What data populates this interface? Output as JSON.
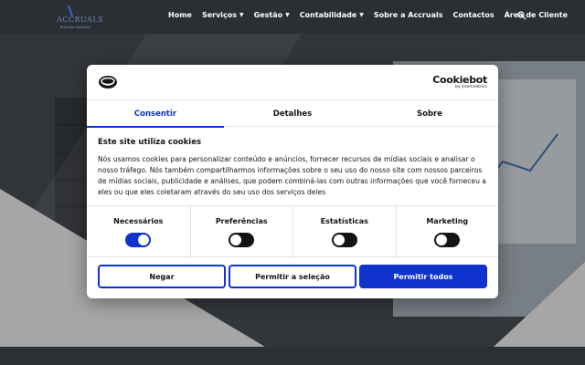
{
  "header": {
    "logo_name": "ACCRUALS",
    "logo_tagline": "Business Solutions",
    "nav": [
      {
        "label": "Home",
        "dropdown": false
      },
      {
        "label": "Serviços",
        "dropdown": true
      },
      {
        "label": "Gestão",
        "dropdown": true
      },
      {
        "label": "Contabilidade",
        "dropdown": true
      },
      {
        "label": "Sobre a Accruals",
        "dropdown": false
      },
      {
        "label": "Contactos",
        "dropdown": false
      },
      {
        "label": "Área de Cliente",
        "dropdown": false
      }
    ]
  },
  "consent": {
    "brand_name": "Cookiebot",
    "brand_sub": "by Usercentrics",
    "tabs": [
      {
        "label": "Consentir",
        "active": true
      },
      {
        "label": "Detalhes",
        "active": false
      },
      {
        "label": "Sobre",
        "active": false
      }
    ],
    "heading": "Este site utiliza cookies",
    "text": "Nós usamos cookies para personalizar conteúdo e anúncios, fornecer recursos de mídias sociais e analisar o nosso tráfego. Nós também compartilharmos informações sobre o seu uso do nosso site com nossos parceiros de mídias sociais, publicidade e análises, que podem combiná-las com outras informações que você forneceu a eles ou que eles coletaram através do seu uso dos serviços deles",
    "toggles": [
      {
        "label": "Necessários",
        "on": true
      },
      {
        "label": "Preferências",
        "on": false
      },
      {
        "label": "Estatísticas",
        "on": false
      },
      {
        "label": "Marketing",
        "on": false
      }
    ],
    "buttons": {
      "deny": "Negar",
      "allow_selection": "Permitir a seleção",
      "allow_all": "Permitir todos"
    }
  },
  "colors": {
    "accent": "#1032cf",
    "header_bg": "#2b2e33"
  }
}
